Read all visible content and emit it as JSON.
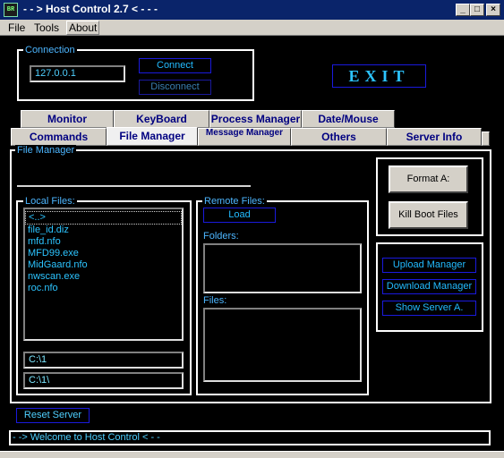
{
  "window": {
    "title": "- - > Host Control 2.7 < - - -",
    "icon": "app-icon",
    "controls": [
      "minimize",
      "maximize",
      "close"
    ]
  },
  "menu": [
    "File",
    "Tools",
    "About"
  ],
  "connection": {
    "label": "Connection",
    "host_value": "127.0.0.1",
    "connect_label": "Connect",
    "disconnect_label": "Disconnect"
  },
  "exit_label": "EXIT",
  "tabs_row1": [
    "Monitor",
    "KeyBoard",
    "Process Manager",
    "Date/Mouse"
  ],
  "tabs_row2": [
    "Commands",
    "File Manager",
    "Message Manager",
    "Others",
    "Server Info"
  ],
  "active_tab": "File Manager",
  "file_manager": {
    "label": "File Manager",
    "local_label": "Local Files:",
    "local_files": [
      "<..>",
      "file_id.diz",
      "mfd.nfo",
      "MFD99.exe",
      "MidGaard.nfo",
      "nwscan.exe",
      "roc.nfo"
    ],
    "path1": "C:\\1",
    "path2": "C:\\1\\",
    "remote_label": "Remote Files:",
    "load_label": "Load",
    "folders_label": "Folders:",
    "files_label": "Files:",
    "format_label": "Format A:",
    "killboot_label": "Kill Boot Files",
    "upload_label": "Upload Manager",
    "download_label": "Download Manager",
    "showserver_label": "Show Server A."
  },
  "reset_label": "Reset Server",
  "status_text": "- -> Welcome to Host Control < - -",
  "colors": {
    "background": "#000000",
    "accent_text": "#22bbff",
    "button_border": "#1a1adc",
    "title_bar": "#0a246a"
  }
}
